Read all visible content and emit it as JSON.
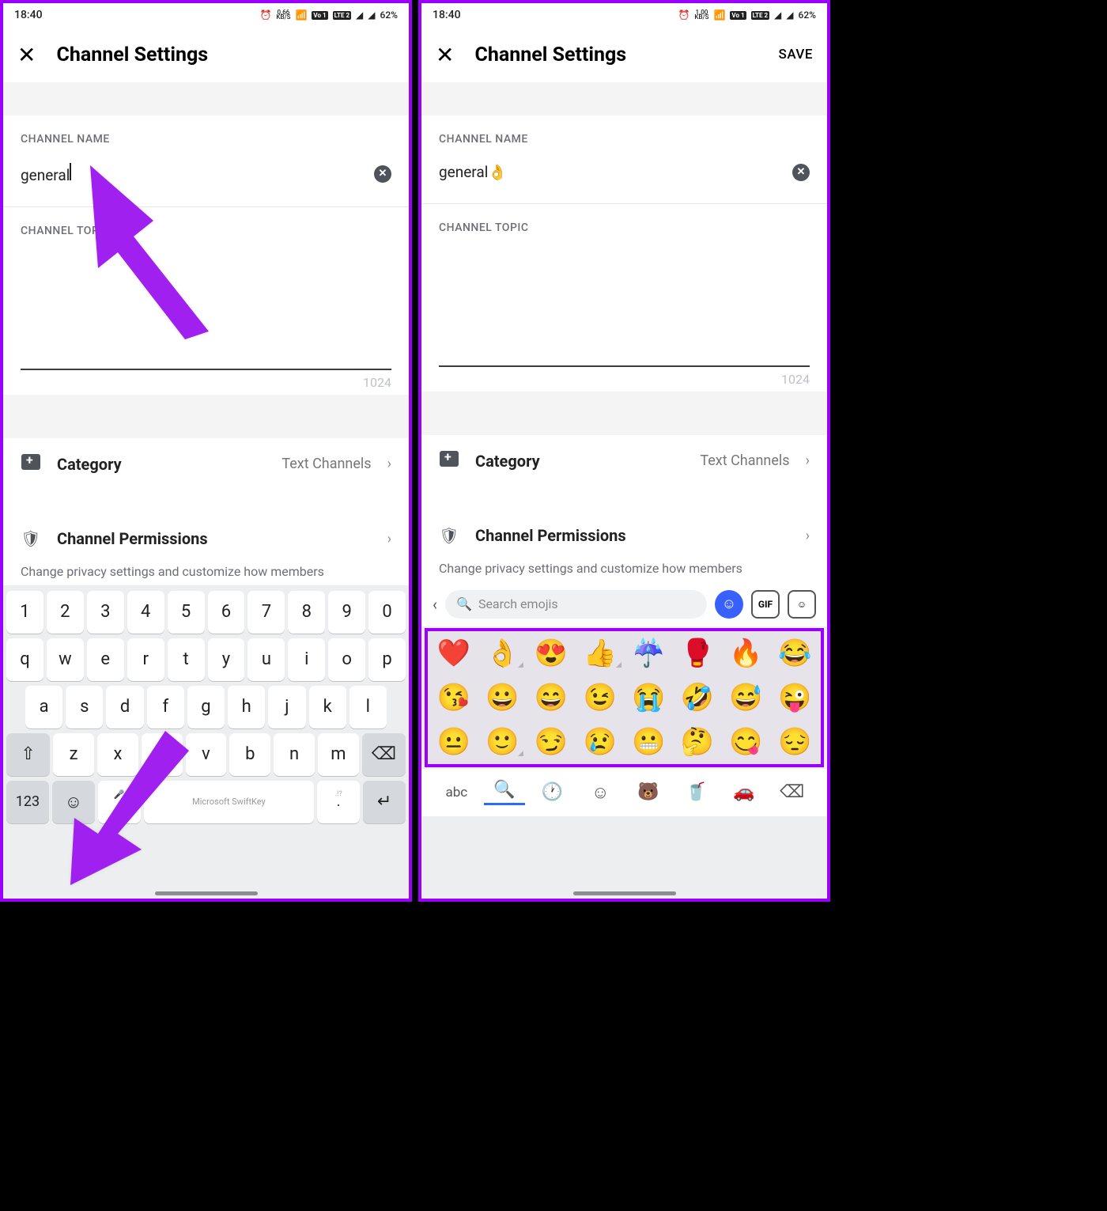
{
  "left": {
    "status": {
      "time": "18:40",
      "kbs": "0.66",
      "kbs_unit": "KB/S",
      "lte1": "Vo 1",
      "lte2": "LTE 2",
      "battery": "62%"
    },
    "header": {
      "title": "Channel Settings"
    },
    "channel_name": {
      "label": "CHANNEL NAME",
      "value": "general"
    },
    "channel_topic": {
      "label": "CHANNEL TOPIC",
      "count": "1024"
    },
    "category": {
      "label": "Category",
      "value": "Text Channels"
    },
    "permissions": {
      "label": "Channel Permissions",
      "sub": "Change privacy settings and customize how members"
    },
    "keyboard": {
      "row1": [
        "1",
        "2",
        "3",
        "4",
        "5",
        "6",
        "7",
        "8",
        "9",
        "0"
      ],
      "row2": [
        "q",
        "w",
        "e",
        "r",
        "t",
        "y",
        "u",
        "i",
        "o",
        "p"
      ],
      "row3": [
        "a",
        "s",
        "d",
        "f",
        "g",
        "h",
        "j",
        "k",
        "l"
      ],
      "row4": [
        "z",
        "x",
        "c",
        "v",
        "b",
        "n",
        "m"
      ],
      "bottom": {
        "num": "123",
        "comma": ",",
        "space": "Microsoft SwiftKey",
        "period": "."
      }
    }
  },
  "right": {
    "status": {
      "time": "18:40",
      "kbs": "1.00",
      "kbs_unit": "KB/S",
      "lte1": "Vo 1",
      "lte2": "LTE 2",
      "battery": "62%"
    },
    "header": {
      "title": "Channel Settings",
      "save": "SAVE"
    },
    "channel_name": {
      "label": "CHANNEL NAME",
      "value": "general👌"
    },
    "channel_topic": {
      "label": "CHANNEL TOPIC",
      "count": "1024"
    },
    "category": {
      "label": "Category",
      "value": "Text Channels"
    },
    "permissions": {
      "label": "Channel Permissions",
      "sub": "Change privacy settings and customize how members"
    },
    "emoji": {
      "search_placeholder": "Search emojis",
      "gif": "GIF",
      "grid": [
        "❤️",
        "👌",
        "😍",
        "👍",
        "☔",
        "🥊",
        "🔥",
        "😂",
        "😘",
        "😀",
        "😄",
        "😉",
        "😭",
        "🤣",
        "😅",
        "😜",
        "😐",
        "🙂",
        "😏",
        "😢",
        "😬",
        "🤔",
        "😋",
        "😔"
      ],
      "abc": "abc"
    }
  }
}
